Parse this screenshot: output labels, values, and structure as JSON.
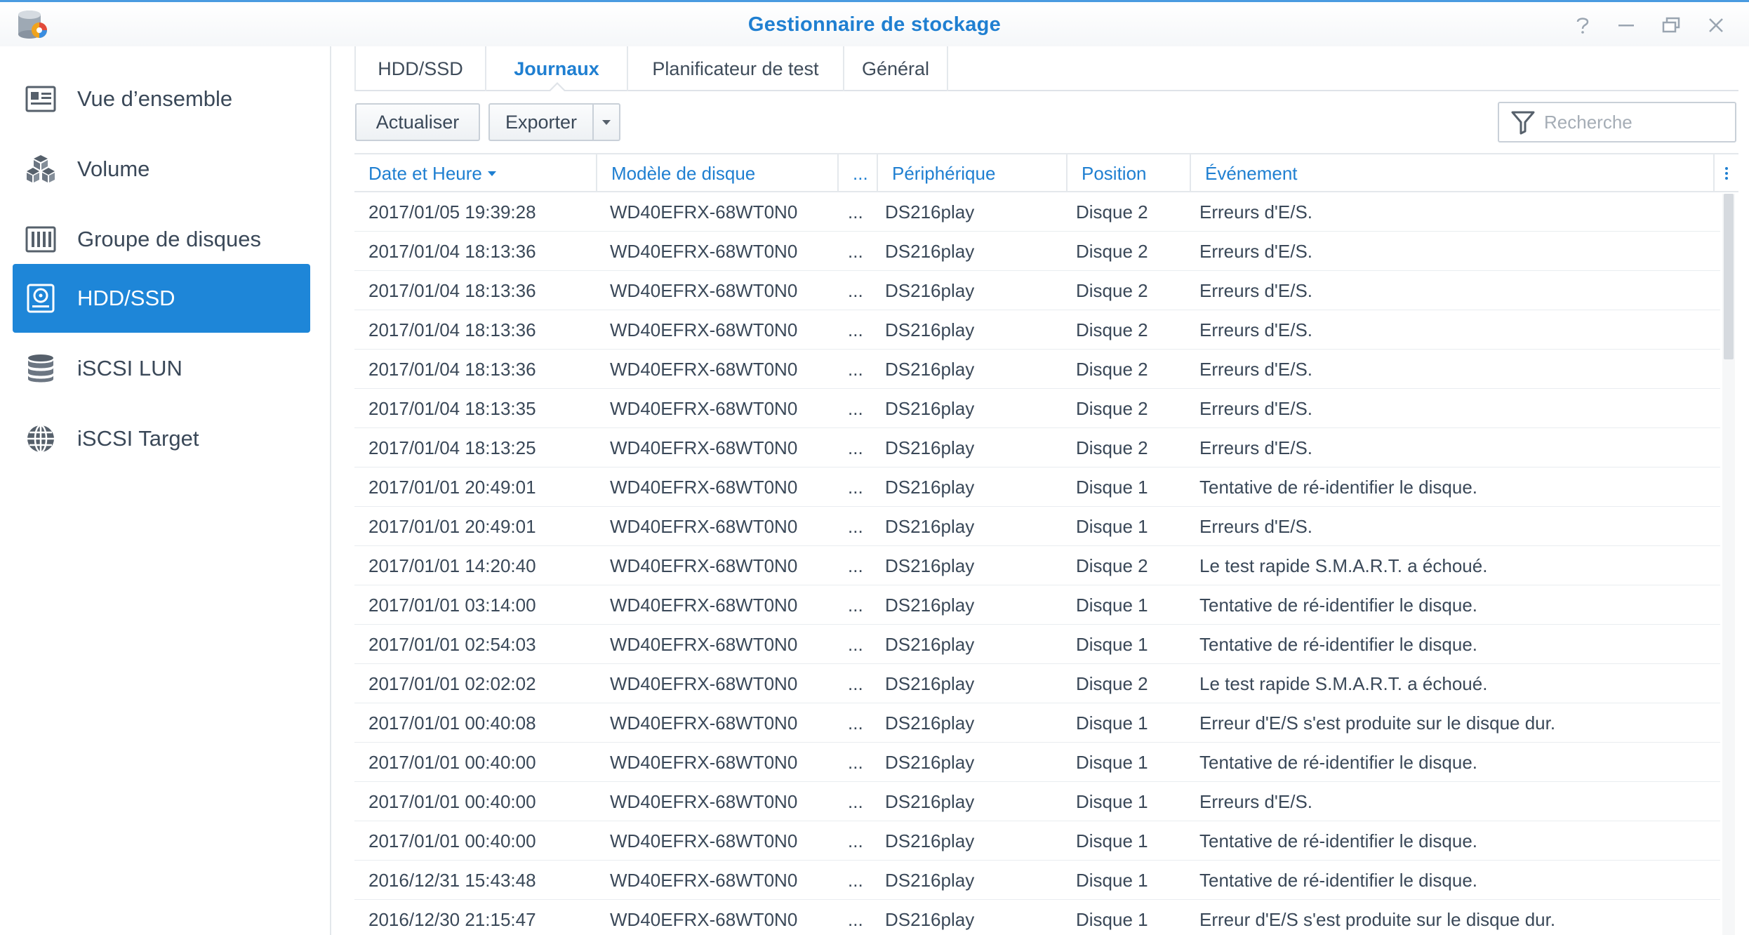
{
  "window": {
    "title": "Gestionnaire de stockage",
    "controls": [
      "help-icon",
      "minimize-icon",
      "restore-icon",
      "close-icon"
    ]
  },
  "sidebar": {
    "items": [
      {
        "label": "Vue d’ensemble",
        "icon": "overview-icon",
        "active": false
      },
      {
        "label": "Volume",
        "icon": "volume-cubes-icon",
        "active": false
      },
      {
        "label": "Groupe de disques",
        "icon": "disk-group-icon",
        "active": false
      },
      {
        "label": "HDD/SSD",
        "icon": "hdd-icon",
        "active": true
      },
      {
        "label": "iSCSI LUN",
        "icon": "database-icon",
        "active": false
      },
      {
        "label": "iSCSI Target",
        "icon": "globe-icon",
        "active": false
      }
    ]
  },
  "tabs": [
    {
      "label": "HDD/SSD",
      "active": false
    },
    {
      "label": "Journaux",
      "active": true
    },
    {
      "label": "Planificateur de test",
      "active": false
    },
    {
      "label": "Général",
      "active": false
    }
  ],
  "toolbar": {
    "refresh_label": "Actualiser",
    "export_label": "Exporter",
    "search_placeholder": "Recherche"
  },
  "table": {
    "columns": [
      "Date et Heure",
      "Modèle de disque",
      "...",
      "Périphérique",
      "Position",
      "Événement"
    ],
    "sorted_column": "Date et Heure",
    "rows": [
      [
        "2017/01/05 19:39:28",
        "WD40EFRX-68WT0N0",
        "...",
        "DS216play",
        "Disque 2",
        "Erreurs d'E/S."
      ],
      [
        "2017/01/04 18:13:36",
        "WD40EFRX-68WT0N0",
        "...",
        "DS216play",
        "Disque 2",
        "Erreurs d'E/S."
      ],
      [
        "2017/01/04 18:13:36",
        "WD40EFRX-68WT0N0",
        "...",
        "DS216play",
        "Disque 2",
        "Erreurs d'E/S."
      ],
      [
        "2017/01/04 18:13:36",
        "WD40EFRX-68WT0N0",
        "...",
        "DS216play",
        "Disque 2",
        "Erreurs d'E/S."
      ],
      [
        "2017/01/04 18:13:36",
        "WD40EFRX-68WT0N0",
        "...",
        "DS216play",
        "Disque 2",
        "Erreurs d'E/S."
      ],
      [
        "2017/01/04 18:13:35",
        "WD40EFRX-68WT0N0",
        "...",
        "DS216play",
        "Disque 2",
        "Erreurs d'E/S."
      ],
      [
        "2017/01/04 18:13:25",
        "WD40EFRX-68WT0N0",
        "...",
        "DS216play",
        "Disque 2",
        "Erreurs d'E/S."
      ],
      [
        "2017/01/01 20:49:01",
        "WD40EFRX-68WT0N0",
        "...",
        "DS216play",
        "Disque 1",
        "Tentative de ré-identifier le disque."
      ],
      [
        "2017/01/01 20:49:01",
        "WD40EFRX-68WT0N0",
        "...",
        "DS216play",
        "Disque 1",
        "Erreurs d'E/S."
      ],
      [
        "2017/01/01 14:20:40",
        "WD40EFRX-68WT0N0",
        "...",
        "DS216play",
        "Disque 2",
        "Le test rapide S.M.A.R.T. a échoué."
      ],
      [
        "2017/01/01 03:14:00",
        "WD40EFRX-68WT0N0",
        "...",
        "DS216play",
        "Disque 1",
        "Tentative de ré-identifier le disque."
      ],
      [
        "2017/01/01 02:54:03",
        "WD40EFRX-68WT0N0",
        "...",
        "DS216play",
        "Disque 1",
        "Tentative de ré-identifier le disque."
      ],
      [
        "2017/01/01 02:02:02",
        "WD40EFRX-68WT0N0",
        "...",
        "DS216play",
        "Disque 2",
        "Le test rapide S.M.A.R.T. a échoué."
      ],
      [
        "2017/01/01 00:40:08",
        "WD40EFRX-68WT0N0",
        "...",
        "DS216play",
        "Disque 1",
        "Erreur d'E/S s'est produite sur le disque dur."
      ],
      [
        "2017/01/01 00:40:00",
        "WD40EFRX-68WT0N0",
        "...",
        "DS216play",
        "Disque 1",
        "Tentative de ré-identifier le disque."
      ],
      [
        "2017/01/01 00:40:00",
        "WD40EFRX-68WT0N0",
        "...",
        "DS216play",
        "Disque 1",
        "Erreurs d'E/S."
      ],
      [
        "2017/01/01 00:40:00",
        "WD40EFRX-68WT0N0",
        "...",
        "DS216play",
        "Disque 1",
        "Tentative de ré-identifier le disque."
      ],
      [
        "2016/12/31 15:43:48",
        "WD40EFRX-68WT0N0",
        "...",
        "DS216play",
        "Disque 1",
        "Tentative de ré-identifier le disque."
      ],
      [
        "2016/12/30 21:15:47",
        "WD40EFRX-68WT0N0",
        "...",
        "DS216play",
        "Disque 1",
        "Erreur d'E/S s'est produite sur le disque dur."
      ]
    ]
  },
  "colors": {
    "accent": "#1e86d8",
    "title": "#1f7fd1",
    "text": "#3a4858",
    "border": "#e4e8ec"
  }
}
